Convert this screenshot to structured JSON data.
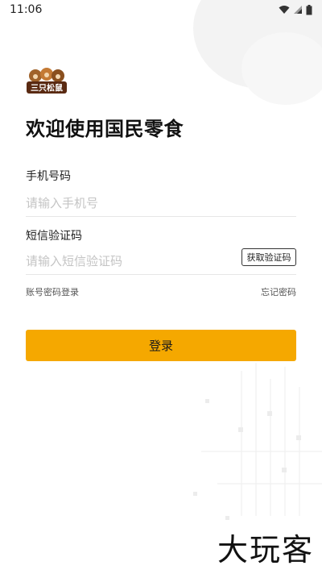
{
  "status_bar": {
    "time": "11:06"
  },
  "logo": {
    "text": "三只松鼠",
    "icon": "brand-logo"
  },
  "page": {
    "title": "欢迎使用国民零食"
  },
  "phone": {
    "label": "手机号码",
    "placeholder": "请输入手机号"
  },
  "sms": {
    "label": "短信验证码",
    "placeholder": "请输入短信验证码",
    "get_code_label": "获取验证码"
  },
  "links": {
    "password_login": "账号密码登录",
    "forgot_password": "忘记密码"
  },
  "actions": {
    "login_label": "登录"
  },
  "watermark": {
    "text": "大玩客"
  },
  "colors": {
    "accent": "#f5a800",
    "background": "#ffffff"
  }
}
